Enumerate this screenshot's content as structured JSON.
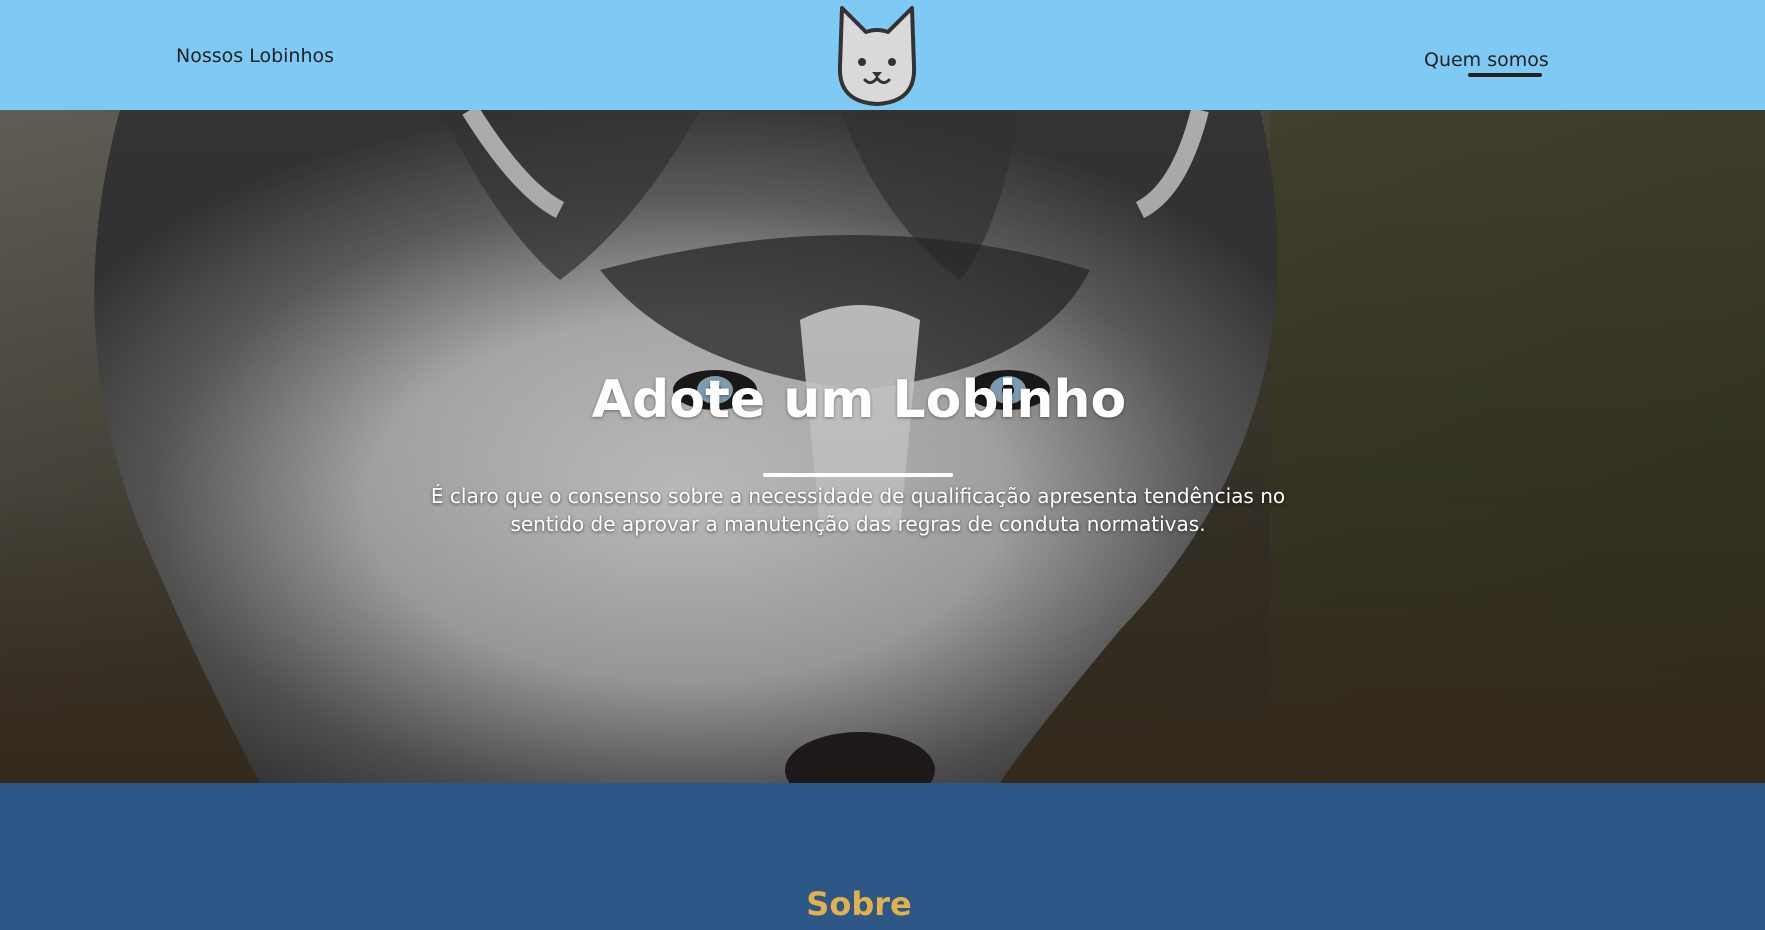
{
  "header": {
    "nav_left": "Nossos Lobinhos",
    "nav_right": "Quem somos",
    "logo_icon": "wolf-face-icon"
  },
  "hero": {
    "title": "Adote um Lobinho",
    "text": "É claro que o consenso sobre a necessidade de qualificação apresenta tendências no sentido de aprovar a manutenção das regras de conduta normativas.",
    "background_image": "husky-photo"
  },
  "about": {
    "title": "Sobre"
  },
  "colors": {
    "header_bg": "#7fcaf5",
    "section_bg": "#2c5786",
    "accent": "#e2b04c"
  }
}
